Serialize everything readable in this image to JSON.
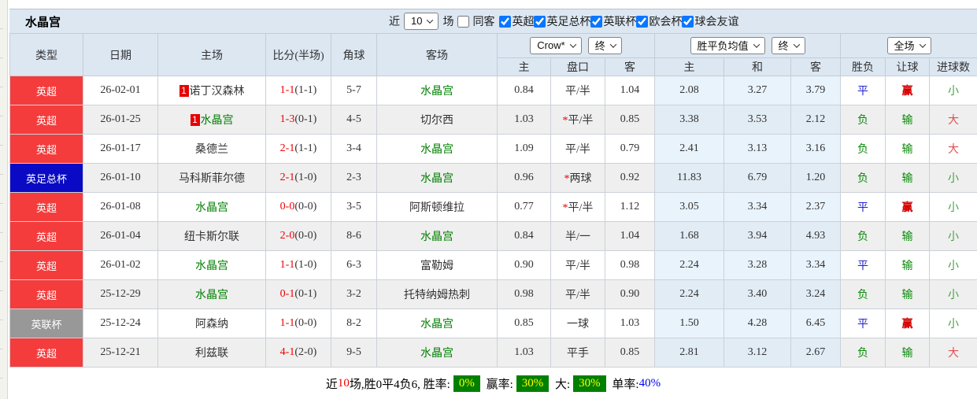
{
  "header": {
    "title": "水晶宫",
    "filter": {
      "recent_label": "近",
      "recent_value": "10",
      "matches_label": "场",
      "checkboxes": [
        {
          "label": "同客",
          "checked": false
        },
        {
          "label": "英超",
          "checked": true
        },
        {
          "label": "英足总杯",
          "checked": true
        },
        {
          "label": "英联杯",
          "checked": true
        },
        {
          "label": "欧会杯",
          "checked": true
        },
        {
          "label": "球会友谊",
          "checked": true
        }
      ]
    }
  },
  "table": {
    "columns": [
      "类型",
      "日期",
      "主场",
      "比分(半场)",
      "角球",
      "客场"
    ],
    "dropdowns": {
      "company": "Crow*",
      "company_period": "终",
      "avg": "胜平负均值",
      "avg_period": "终",
      "scope": "全场"
    },
    "sub_columns": [
      "主",
      "盘口",
      "客",
      "主",
      "和",
      "客",
      "胜负",
      "让球",
      "进球数"
    ],
    "rows": [
      {
        "type": "英超",
        "type_color": "red",
        "date": "26-02-01",
        "home_badge": "1",
        "home": "诺丁汉森林",
        "home_green": false,
        "score": "1-1",
        "half": "(1-1)",
        "corners": "5-7",
        "away": "水晶宫",
        "away_green": true,
        "odds_home": "0.84",
        "handicap_star": "",
        "handicap": "平/半",
        "odds_away": "1.04",
        "avg_home": "2.08",
        "avg_draw": "3.27",
        "avg_away": "3.79",
        "res": "平",
        "res_c": "blue",
        "bet": "赢",
        "bet_c": "win",
        "goal": "小",
        "goal_c": "small"
      },
      {
        "type": "英超",
        "type_color": "red",
        "date": "26-01-25",
        "home_badge": "1",
        "home": "水晶宫",
        "home_green": true,
        "score": "1-3",
        "half": "(0-1)",
        "corners": "4-5",
        "away": "切尔西",
        "away_green": false,
        "odds_home": "1.03",
        "handicap_star": "*",
        "handicap": "平/半",
        "odds_away": "0.85",
        "avg_home": "3.38",
        "avg_draw": "3.53",
        "avg_away": "2.12",
        "res": "负",
        "res_c": "green",
        "bet": "输",
        "bet_c": "lose",
        "goal": "大",
        "goal_c": "big"
      },
      {
        "type": "英超",
        "type_color": "red",
        "date": "26-01-17",
        "home_badge": "",
        "home": "桑德兰",
        "home_green": false,
        "score": "2-1",
        "half": "(1-1)",
        "corners": "3-4",
        "away": "水晶宫",
        "away_green": true,
        "odds_home": "1.09",
        "handicap_star": "",
        "handicap": "平/半",
        "odds_away": "0.79",
        "avg_home": "2.41",
        "avg_draw": "3.13",
        "avg_away": "3.16",
        "res": "负",
        "res_c": "green",
        "bet": "输",
        "bet_c": "lose",
        "goal": "大",
        "goal_c": "big"
      },
      {
        "type": "英足总杯",
        "type_color": "blue",
        "date": "26-01-10",
        "home_badge": "",
        "home": "马科斯菲尔德",
        "home_green": false,
        "score": "2-1",
        "half": "(1-0)",
        "corners": "2-3",
        "away": "水晶宫",
        "away_green": true,
        "odds_home": "0.96",
        "handicap_star": "*",
        "handicap": "两球",
        "odds_away": "0.92",
        "avg_home": "11.83",
        "avg_draw": "6.79",
        "avg_away": "1.20",
        "res": "负",
        "res_c": "green",
        "bet": "输",
        "bet_c": "lose",
        "goal": "小",
        "goal_c": "small"
      },
      {
        "type": "英超",
        "type_color": "red",
        "date": "26-01-08",
        "home_badge": "",
        "home": "水晶宫",
        "home_green": true,
        "score": "0-0",
        "half": "(0-0)",
        "corners": "3-5",
        "away": "阿斯顿维拉",
        "away_green": false,
        "odds_home": "0.77",
        "handicap_star": "*",
        "handicap": "平/半",
        "odds_away": "1.12",
        "avg_home": "3.05",
        "avg_draw": "3.34",
        "avg_away": "2.37",
        "res": "平",
        "res_c": "blue",
        "bet": "赢",
        "bet_c": "win",
        "goal": "小",
        "goal_c": "small"
      },
      {
        "type": "英超",
        "type_color": "red",
        "date": "26-01-04",
        "home_badge": "",
        "home": "纽卡斯尔联",
        "home_green": false,
        "score": "2-0",
        "half": "(0-0)",
        "corners": "8-6",
        "away": "水晶宫",
        "away_green": true,
        "odds_home": "0.84",
        "handicap_star": "",
        "handicap": "半/一",
        "odds_away": "1.04",
        "avg_home": "1.68",
        "avg_draw": "3.94",
        "avg_away": "4.93",
        "res": "负",
        "res_c": "green",
        "bet": "输",
        "bet_c": "lose",
        "goal": "小",
        "goal_c": "small"
      },
      {
        "type": "英超",
        "type_color": "red",
        "date": "26-01-02",
        "home_badge": "",
        "home": "水晶宫",
        "home_green": true,
        "score": "1-1",
        "half": "(1-0)",
        "corners": "6-3",
        "away": "富勒姆",
        "away_green": false,
        "odds_home": "0.90",
        "handicap_star": "",
        "handicap": "平/半",
        "odds_away": "0.98",
        "avg_home": "2.24",
        "avg_draw": "3.28",
        "avg_away": "3.34",
        "res": "平",
        "res_c": "blue",
        "bet": "输",
        "bet_c": "lose",
        "goal": "小",
        "goal_c": "small"
      },
      {
        "type": "英超",
        "type_color": "red",
        "date": "25-12-29",
        "home_badge": "",
        "home": "水晶宫",
        "home_green": true,
        "score": "0-1",
        "half": "(0-1)",
        "corners": "3-2",
        "away": "托特纳姆热刺",
        "away_green": false,
        "odds_home": "0.98",
        "handicap_star": "",
        "handicap": "平/半",
        "odds_away": "0.90",
        "avg_home": "2.24",
        "avg_draw": "3.40",
        "avg_away": "3.24",
        "res": "负",
        "res_c": "green",
        "bet": "输",
        "bet_c": "lose",
        "goal": "小",
        "goal_c": "small"
      },
      {
        "type": "英联杯",
        "type_color": "gray",
        "date": "25-12-24",
        "home_badge": "",
        "home": "阿森纳",
        "home_green": false,
        "score": "1-1",
        "half": "(0-0)",
        "corners": "8-2",
        "away": "水晶宫",
        "away_green": true,
        "odds_home": "0.85",
        "handicap_star": "",
        "handicap": "一球",
        "odds_away": "1.03",
        "avg_home": "1.50",
        "avg_draw": "4.28",
        "avg_away": "6.45",
        "res": "平",
        "res_c": "blue",
        "bet": "赢",
        "bet_c": "win",
        "goal": "小",
        "goal_c": "small"
      },
      {
        "type": "英超",
        "type_color": "red",
        "date": "25-12-21",
        "home_badge": "",
        "home": "利兹联",
        "home_green": false,
        "score": "4-1",
        "half": "(2-0)",
        "corners": "9-5",
        "away": "水晶宫",
        "away_green": true,
        "odds_home": "1.03",
        "handicap_star": "",
        "handicap": "平手",
        "odds_away": "0.85",
        "avg_home": "2.81",
        "avg_draw": "3.12",
        "avg_away": "2.67",
        "res": "负",
        "res_c": "green",
        "bet": "输",
        "bet_c": "lose",
        "goal": "大",
        "goal_c": "big"
      }
    ]
  },
  "footer": {
    "segments": [
      {
        "text": "近",
        "style": "plain"
      },
      {
        "text": "10",
        "style": "red"
      },
      {
        "text": "场,胜0平4负6, 胜率:",
        "style": "plain"
      },
      {
        "text": "0%",
        "style": "badge"
      },
      {
        "text": " 赢率:",
        "style": "plain"
      },
      {
        "text": "30%",
        "style": "badge"
      },
      {
        "text": " 大:",
        "style": "plain"
      },
      {
        "text": "30%",
        "style": "badge"
      },
      {
        "text": " 单率:",
        "style": "plain"
      },
      {
        "text": "40%",
        "style": "blue"
      }
    ]
  }
}
